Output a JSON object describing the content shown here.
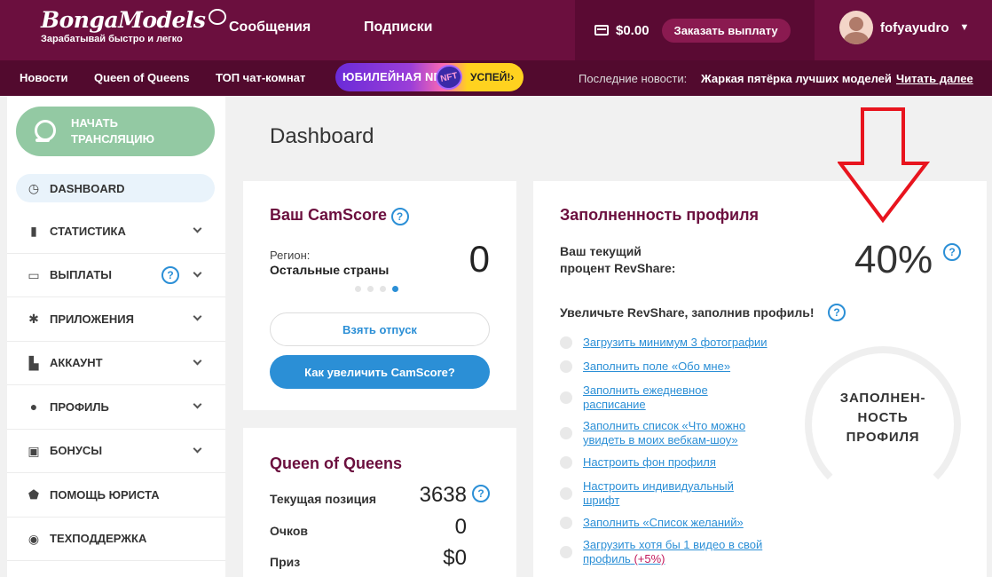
{
  "header": {
    "brand": "BongaModels",
    "tagline": "Зарабатывай быстро и легко",
    "nav": [
      "Сообщения",
      "Подписки"
    ],
    "balance": "$0.00",
    "payout_label": "Заказать выплату",
    "username": "fofyayudro"
  },
  "subnav": {
    "items": [
      "Новости",
      "Queen of Queens",
      "ТОП чат-комнат"
    ],
    "banner_text": "ЮБИЛЕЙНАЯ NFT-К",
    "banner_coin": "NFT",
    "banner_cta": "УСПЕЙ!›",
    "news_label": "Последние новости:",
    "news_text": "Жаркая пятёрка лучших моделей",
    "news_link": "Читать далее"
  },
  "sidebar": {
    "stream_line1": "НАЧАТЬ",
    "stream_line2": "ТРАНСЛЯЦИЮ",
    "items": [
      {
        "label": "DASHBOARD"
      },
      {
        "label": "СТАТИСТИКА"
      },
      {
        "label": "ВЫПЛАТЫ"
      },
      {
        "label": "ПРИЛОЖЕНИЯ"
      },
      {
        "label": "АККАУНТ"
      },
      {
        "label": "ПРОФИЛЬ"
      },
      {
        "label": "БОНУСЫ"
      },
      {
        "label": "ПОМОЩЬ ЮРИСТА"
      },
      {
        "label": "ТЕХПОДДЕРЖКА"
      }
    ]
  },
  "main": {
    "title": "Dashboard",
    "camscore": {
      "title": "Ваш CamScore",
      "help": "?",
      "region_label": "Регион:",
      "region_value": "Остальные страны",
      "score": "0",
      "vacation_label": "Взять отпуск",
      "increase_label": "Как увеличить CamScore?"
    },
    "queen": {
      "title": "Queen of Queens",
      "position_label": "Текущая позиция",
      "position_value": "3638",
      "points_label": "Очков",
      "points_value": "0",
      "prize_label": "Приз",
      "prize_value": "$0"
    },
    "profile": {
      "title": "Заполненность профиля",
      "revshare_line1": "Ваш текущий",
      "revshare_line2": "процент RevShare:",
      "percent": "40%",
      "boost_label": "Увеличьте RevShare, заполнив профиль!",
      "tasks": [
        "Загрузить минимум 3 фотографии",
        "Заполнить поле «Обо мне»",
        "Заполнить ежедневное расписание",
        "Заполнить список «Что можно увидеть в моих вебкам-шоу»",
        "Настроить фон профиля",
        "Настроить индивидуальный шрифт",
        "Заполнить «Список желаний»",
        "Загрузить хотя бы 1 видео в свой профиль"
      ],
      "video_bonus": "(+5%)",
      "ring_line1": "ЗАПОЛНЕН-",
      "ring_line2": "НОСТЬ",
      "ring_line3": "ПРОФИЛЯ"
    }
  },
  "colors": {
    "header_bg": "#6b0f3e",
    "subbar_bg": "#520a2e",
    "accent_blue": "#2b8fd6",
    "stream_green": "#93c9a3",
    "annotation_red": "#e8141e"
  }
}
